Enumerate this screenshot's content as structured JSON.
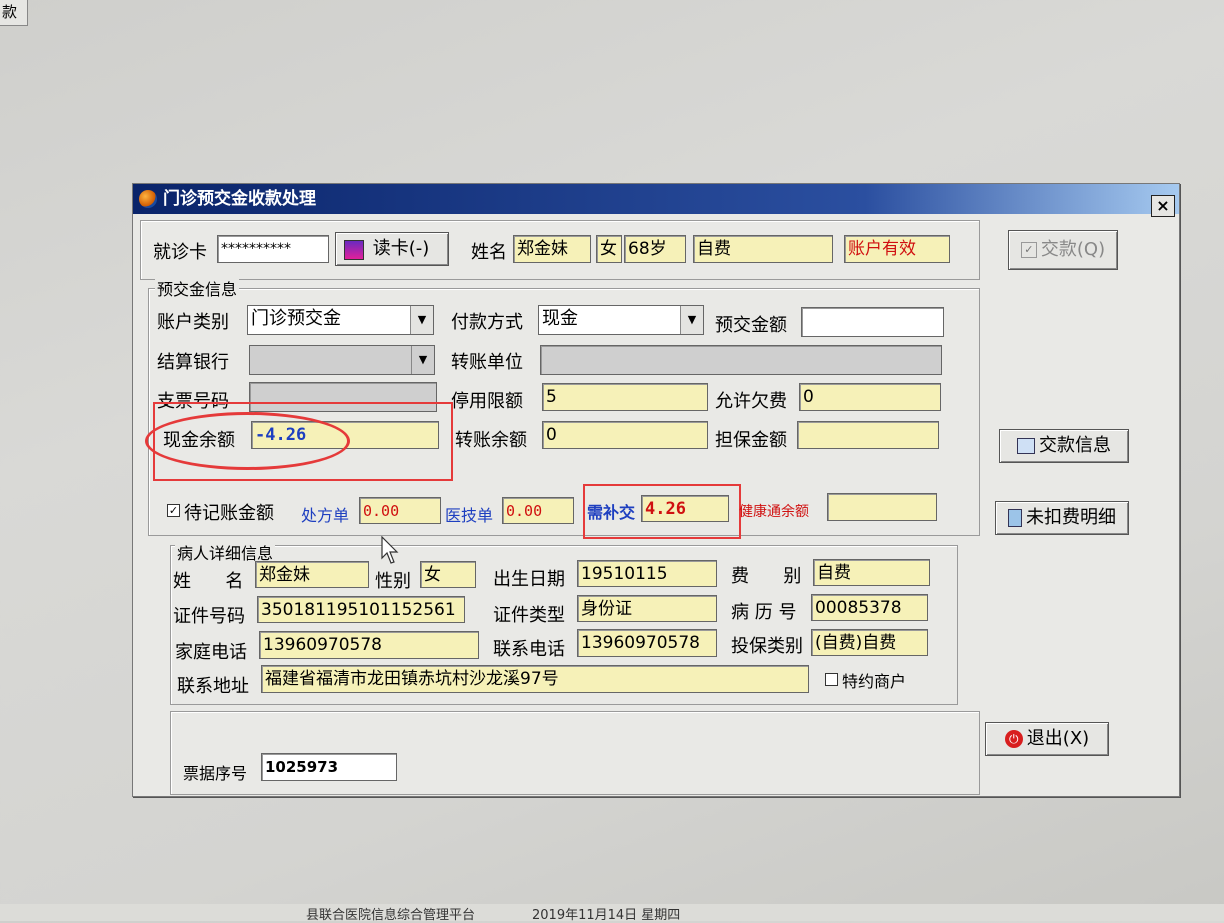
{
  "background_tab": "款",
  "dialog": {
    "title": "门诊预交金收款处理",
    "close": "×"
  },
  "header": {
    "card_label": "就诊卡",
    "card_value": "**********",
    "read_card_label": "读卡(-)",
    "name_label": "姓名",
    "name_value": "郑金妹",
    "gender_value": "女",
    "age_value": "68岁",
    "payment_type_value": "自费",
    "account_status": "账户有效"
  },
  "deposit": {
    "group_title": "预交金信息",
    "account_type_label": "账户类别",
    "account_type_value": "门诊预交金",
    "pay_method_label": "付款方式",
    "pay_method_value": "现金",
    "deposit_amount_label": "预交金额",
    "deposit_amount_value": "",
    "bank_label": "结算银行",
    "bank_value": "",
    "transfer_unit_label": "转账单位",
    "transfer_unit_value": "",
    "check_no_label": "支票号码",
    "check_no_value": "",
    "suspend_limit_label": "停用限额",
    "suspend_limit_value": "5",
    "allow_debt_label": "允许欠费",
    "allow_debt_value": "0",
    "cash_balance_label": "现金余额",
    "cash_balance_value": "-4.26",
    "transfer_balance_label": "转账余额",
    "transfer_balance_value": "0",
    "guarantee_label": "担保金额",
    "guarantee_value": "",
    "pending_label": "待记账金额",
    "prescription_label": "处方单",
    "prescription_value": "0.00",
    "medtech_label": "医技单",
    "medtech_value": "0.00",
    "need_pay_label": "需补交",
    "need_pay_value": "4.26",
    "health_label": "健康通余额",
    "health_value": ""
  },
  "patient": {
    "group_title": "病人详细信息",
    "name_label": "姓      名",
    "name_value": "郑金妹",
    "gender_label": "性别",
    "gender_value": "女",
    "birth_label": "出生日期",
    "birth_value": "19510115",
    "fee_label": "费      别",
    "fee_value": "自费",
    "id_label": "证件号码",
    "id_value": "350181195101152561",
    "id_type_label": "证件类型",
    "id_type_value": "身份证",
    "record_label": "病 历 号",
    "record_value": "00085378",
    "home_phone_label": "家庭电话",
    "home_phone_value": "13960970578",
    "contact_phone_label": "联系电话",
    "contact_phone_value": "13960970578",
    "insure_label": "投保类别",
    "insure_value": "(自费)自费",
    "address_label": "联系地址",
    "address_value": "福建省福清市龙田镇赤坑村沙龙溪97号",
    "special_label": "特约商户"
  },
  "receipt": {
    "label": "票据序号",
    "value": "1025973"
  },
  "buttons": {
    "pay": "交款(Q)",
    "pay_info": "交款信息",
    "undeducted": "未扣费明细",
    "exit": "退出(X)"
  },
  "status_bar": {
    "platform": "县联合医院信息综合管理平台",
    "date": "2019年11月14日 星期四"
  }
}
